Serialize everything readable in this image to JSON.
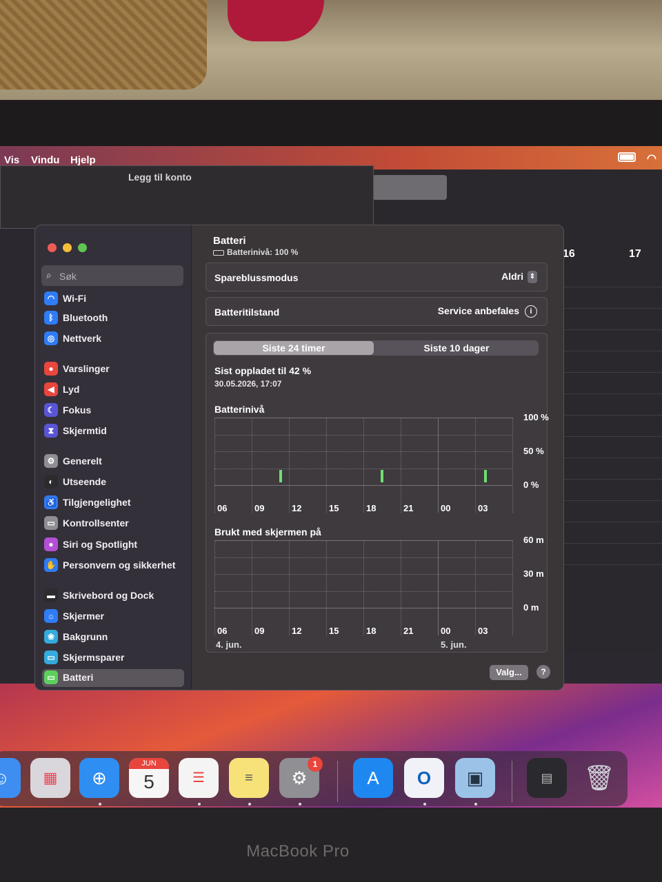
{
  "menubar": {
    "items": [
      "Vis",
      "Vindu",
      "Hjelp"
    ]
  },
  "background_window": {
    "title": "Legg til konto",
    "calendar_days": [
      "16",
      "17"
    ]
  },
  "sidebar": {
    "search_placeholder": "Søk",
    "items": [
      {
        "label": "Wi-Fi",
        "icon": "wifi-icon",
        "color": "#2f7cf6"
      },
      {
        "label": "Bluetooth",
        "icon": "bluetooth-icon",
        "color": "#2f7cf6"
      },
      {
        "label": "Nettverk",
        "icon": "globe-icon",
        "color": "#2f7cf6"
      },
      {
        "label": "Varslinger",
        "icon": "bell-icon",
        "color": "#e9463d"
      },
      {
        "label": "Lyd",
        "icon": "speaker-icon",
        "color": "#e9463d"
      },
      {
        "label": "Fokus",
        "icon": "moon-icon",
        "color": "#5a55d6"
      },
      {
        "label": "Skjermtid",
        "icon": "hourglass-icon",
        "color": "#5a55d6"
      },
      {
        "label": "Generelt",
        "icon": "gear-icon",
        "color": "#8e8e93"
      },
      {
        "label": "Utseende",
        "icon": "appearance-icon",
        "color": "#2c2c2e"
      },
      {
        "label": "Tilgjengelighet",
        "icon": "accessibility-icon",
        "color": "#2f7cf6"
      },
      {
        "label": "Kontrollsenter",
        "icon": "control-center-icon",
        "color": "#8e8e93"
      },
      {
        "label": "Siri og Spotlight",
        "icon": "siri-icon",
        "color": "#b44fd6"
      },
      {
        "label": "Personvern og sikkerhet",
        "icon": "hand-icon",
        "color": "#2f7cf6"
      },
      {
        "label": "Skrivebord og Dock",
        "icon": "dock-icon",
        "color": "#2c2c2e"
      },
      {
        "label": "Skjermer",
        "icon": "display-icon",
        "color": "#2f7cf6"
      },
      {
        "label": "Bakgrunn",
        "icon": "wallpaper-icon",
        "color": "#35aadc"
      },
      {
        "label": "Skjermsparer",
        "icon": "screensaver-icon",
        "color": "#35aadc"
      },
      {
        "label": "Batteri",
        "icon": "battery-icon",
        "color": "#5ccf5c"
      }
    ]
  },
  "content": {
    "title": "Batteri",
    "subtitle": "Batterinivå: 100 %",
    "low_power": {
      "label": "Spareblussmodus",
      "value": "Aldri"
    },
    "health": {
      "label": "Batteritilstand",
      "value": "Service anbefales"
    },
    "tabs": [
      "Siste 24 timer",
      "Siste 10 dager"
    ],
    "last_charged": "Sist oppladet til 42 %",
    "last_charged_date": "30.05.2026, 17:07",
    "battery_chart": {
      "label": "Batterinivå",
      "y_labels": [
        "100 %",
        "50 %",
        "0 %"
      ],
      "x_labels": [
        "06",
        "09",
        "12",
        "15",
        "18",
        "21",
        "00",
        "03"
      ]
    },
    "screen_chart": {
      "label": "Brukt med skjermen på",
      "y_labels": [
        "60 m",
        "30 m",
        "0 m"
      ],
      "x_labels": [
        "06",
        "09",
        "12",
        "15",
        "18",
        "21",
        "00",
        "03"
      ],
      "dates": [
        "4. jun.",
        "5. jun."
      ]
    },
    "options_button": "Valg...",
    "help_button": "?"
  },
  "dock": {
    "apps": [
      "Finder",
      "Launchpad",
      "Safari",
      "Kalender",
      "Påminnelser",
      "Notater",
      "Systeminnstillinger",
      "App Store",
      "Outlook",
      "Forhåndsvisning",
      "Vinduer",
      "Papirkurv"
    ],
    "calendar_month": "JUN",
    "calendar_day": "5",
    "settings_badge": "1"
  },
  "device_label": "MacBook Pro"
}
